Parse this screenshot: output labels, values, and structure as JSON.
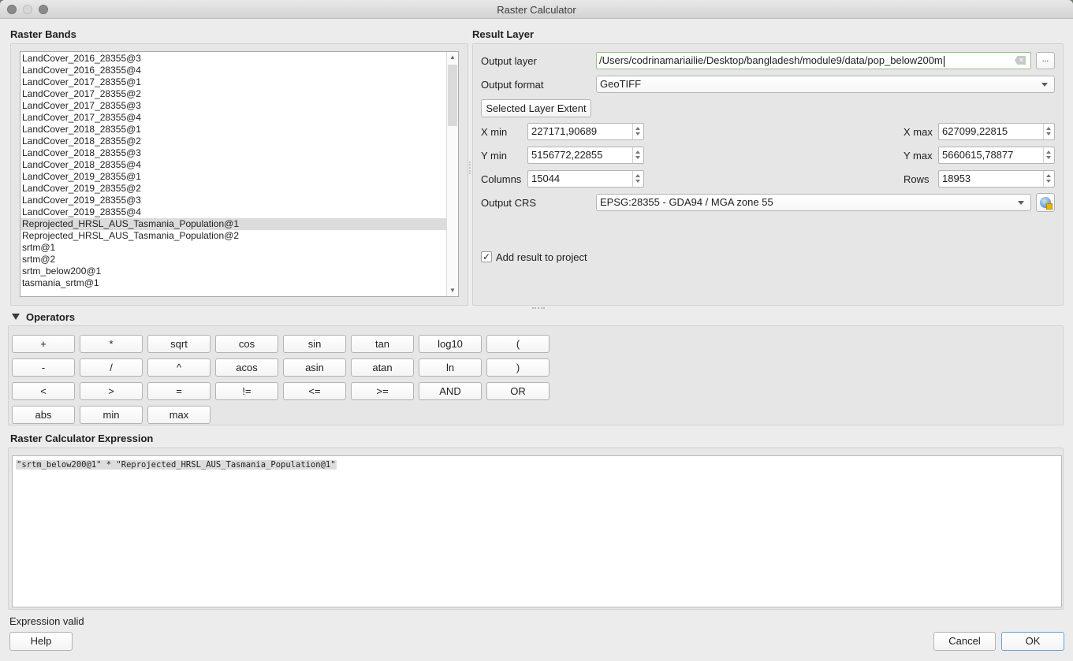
{
  "window": {
    "title": "Raster Calculator"
  },
  "raster_bands": {
    "heading": "Raster Bands",
    "items": [
      "LandCover_2016_28355@3",
      "LandCover_2016_28355@4",
      "LandCover_2017_28355@1",
      "LandCover_2017_28355@2",
      "LandCover_2017_28355@3",
      "LandCover_2017_28355@4",
      "LandCover_2018_28355@1",
      "LandCover_2018_28355@2",
      "LandCover_2018_28355@3",
      "LandCover_2018_28355@4",
      "LandCover_2019_28355@1",
      "LandCover_2019_28355@2",
      "LandCover_2019_28355@3",
      "LandCover_2019_28355@4",
      "Reprojected_HRSL_AUS_Tasmania_Population@1",
      "Reprojected_HRSL_AUS_Tasmania_Population@2",
      "srtm@1",
      "srtm@2",
      "srtm_below200@1",
      "tasmania_srtm@1"
    ],
    "selected_index": 14
  },
  "result_layer": {
    "heading": "Result Layer",
    "output_layer_label": "Output layer",
    "output_layer_value": "/Users/codrinamariailie/Desktop/bangladesh/module9/data/pop_below200m",
    "browse_label": "...",
    "output_format_label": "Output format",
    "output_format_value": "GeoTIFF",
    "selected_extent_label": "Selected Layer Extent",
    "xmin_label": "X min",
    "xmin_value": "227171,90689",
    "xmax_label": "X max",
    "xmax_value": "627099,22815",
    "ymin_label": "Y min",
    "ymin_value": "5156772,22855",
    "ymax_label": "Y max",
    "ymax_value": "5660615,78877",
    "columns_label": "Columns",
    "columns_value": "15044",
    "rows_label": "Rows",
    "rows_value": "18953",
    "crs_label": "Output CRS",
    "crs_value": "EPSG:28355 - GDA94 / MGA zone 55",
    "add_to_project_label": "Add result to project",
    "add_to_project_checked": true,
    "check_glyph": "✓"
  },
  "operators": {
    "heading": "Operators",
    "rows": [
      [
        "+",
        "*",
        "sqrt",
        "cos",
        "sin",
        "tan",
        "log10",
        "("
      ],
      [
        "-",
        "/",
        "^",
        "acos",
        "asin",
        "atan",
        "ln",
        ")"
      ],
      [
        "<",
        ">",
        "=",
        "!=",
        "<=",
        ">=",
        "AND",
        "OR"
      ],
      [
        "abs",
        "min",
        "max"
      ]
    ]
  },
  "expression": {
    "heading": "Raster Calculator Expression",
    "value": "\"srtm_below200@1\" * \"Reprojected_HRSL_AUS_Tasmania_Population@1\""
  },
  "footer": {
    "status": "Expression valid",
    "help_label": "Help",
    "cancel_label": "Cancel",
    "ok_label": "OK"
  }
}
